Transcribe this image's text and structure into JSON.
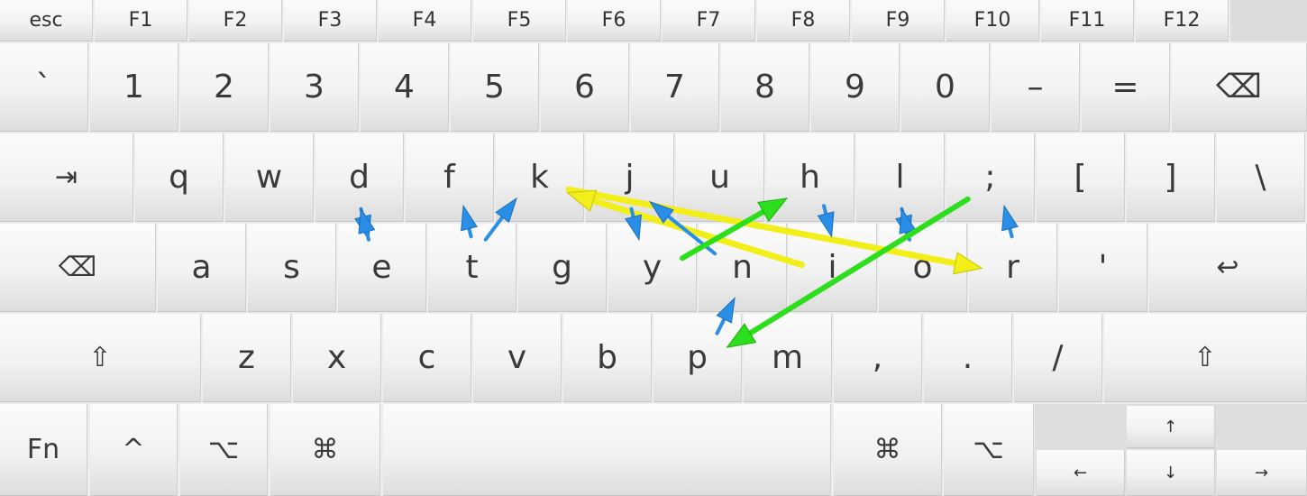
{
  "keyboard": {
    "function_row": [
      "esc",
      "F1",
      "F2",
      "F3",
      "F4",
      "F5",
      "F6",
      "F7",
      "F8",
      "F9",
      "F10",
      "F11",
      "F12"
    ],
    "number_row": [
      "`",
      "1",
      "2",
      "3",
      "4",
      "5",
      "6",
      "7",
      "8",
      "9",
      "0",
      "–",
      "=",
      "⌫"
    ],
    "tab_row": [
      "⇥",
      "q",
      "w",
      "d",
      "f",
      "k",
      "j",
      "u",
      "h",
      "l",
      ";",
      "[",
      "]",
      "\\"
    ],
    "home_row": [
      "⌫",
      "a",
      "s",
      "e",
      "t",
      "g",
      "y",
      "n",
      "i",
      "o",
      "r",
      "'",
      "↩"
    ],
    "shift_row": [
      "⇧",
      "z",
      "x",
      "c",
      "v",
      "b",
      "p",
      "m",
      ",",
      ".",
      "/",
      "⇧"
    ],
    "bottom_row": [
      "Fn",
      "^",
      "⌥",
      "⌘",
      "",
      "⌘",
      "⌥"
    ],
    "arrow_keys": {
      "up": "↑",
      "left": "←",
      "down": "↓",
      "right": "→"
    }
  },
  "overlay_arrows": {
    "colors": {
      "yellow": "#f2ee1a",
      "green": "#2dde1d",
      "blue": "#2a8ee6"
    },
    "transitions": [
      {
        "from": "d",
        "to": "e",
        "color": "blue"
      },
      {
        "from": "e",
        "to": "d",
        "color": "blue"
      },
      {
        "from": "t",
        "to": "f",
        "color": "blue"
      },
      {
        "from": "t",
        "to": "k",
        "color": "blue"
      },
      {
        "from": "k",
        "to": "r",
        "color": "yellow"
      },
      {
        "from": "i",
        "to": "k",
        "color": "yellow"
      },
      {
        "from": "j",
        "to": "y",
        "color": "blue"
      },
      {
        "from": "n",
        "to": "j",
        "color": "blue"
      },
      {
        "from": "y",
        "to": "h",
        "color": "green"
      },
      {
        "from": "h",
        "to": "i",
        "color": "blue"
      },
      {
        "from": "l",
        "to": "o",
        "color": "blue"
      },
      {
        "from": "o",
        "to": "l",
        "color": "blue"
      },
      {
        "from": "r",
        "to": ";",
        "color": "blue"
      },
      {
        "from": ";",
        "to": "p",
        "color": "green"
      },
      {
        "from": "p",
        "to": "n",
        "color": "blue"
      }
    ]
  }
}
